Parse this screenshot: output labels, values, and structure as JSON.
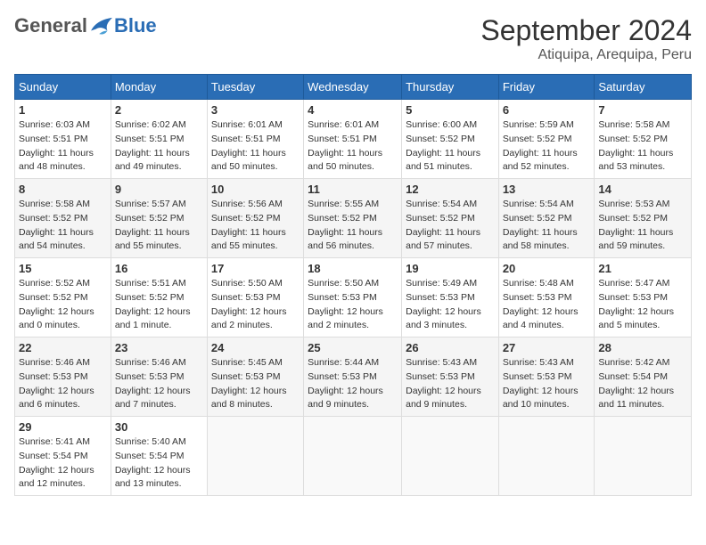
{
  "header": {
    "logo_general": "General",
    "logo_blue": "Blue",
    "title": "September 2024",
    "subtitle": "Atiquipa, Arequipa, Peru"
  },
  "weekdays": [
    "Sunday",
    "Monday",
    "Tuesday",
    "Wednesday",
    "Thursday",
    "Friday",
    "Saturday"
  ],
  "weeks": [
    [
      {
        "day": 1,
        "sunrise": "6:03 AM",
        "sunset": "5:51 PM",
        "daylight": "11 hours and 48 minutes."
      },
      {
        "day": 2,
        "sunrise": "6:02 AM",
        "sunset": "5:51 PM",
        "daylight": "11 hours and 49 minutes."
      },
      {
        "day": 3,
        "sunrise": "6:01 AM",
        "sunset": "5:51 PM",
        "daylight": "11 hours and 50 minutes."
      },
      {
        "day": 4,
        "sunrise": "6:01 AM",
        "sunset": "5:51 PM",
        "daylight": "11 hours and 50 minutes."
      },
      {
        "day": 5,
        "sunrise": "6:00 AM",
        "sunset": "5:52 PM",
        "daylight": "11 hours and 51 minutes."
      },
      {
        "day": 6,
        "sunrise": "5:59 AM",
        "sunset": "5:52 PM",
        "daylight": "11 hours and 52 minutes."
      },
      {
        "day": 7,
        "sunrise": "5:58 AM",
        "sunset": "5:52 PM",
        "daylight": "11 hours and 53 minutes."
      }
    ],
    [
      {
        "day": 8,
        "sunrise": "5:58 AM",
        "sunset": "5:52 PM",
        "daylight": "11 hours and 54 minutes."
      },
      {
        "day": 9,
        "sunrise": "5:57 AM",
        "sunset": "5:52 PM",
        "daylight": "11 hours and 55 minutes."
      },
      {
        "day": 10,
        "sunrise": "5:56 AM",
        "sunset": "5:52 PM",
        "daylight": "11 hours and 55 minutes."
      },
      {
        "day": 11,
        "sunrise": "5:55 AM",
        "sunset": "5:52 PM",
        "daylight": "11 hours and 56 minutes."
      },
      {
        "day": 12,
        "sunrise": "5:54 AM",
        "sunset": "5:52 PM",
        "daylight": "11 hours and 57 minutes."
      },
      {
        "day": 13,
        "sunrise": "5:54 AM",
        "sunset": "5:52 PM",
        "daylight": "11 hours and 58 minutes."
      },
      {
        "day": 14,
        "sunrise": "5:53 AM",
        "sunset": "5:52 PM",
        "daylight": "11 hours and 59 minutes."
      }
    ],
    [
      {
        "day": 15,
        "sunrise": "5:52 AM",
        "sunset": "5:52 PM",
        "daylight": "12 hours and 0 minutes."
      },
      {
        "day": 16,
        "sunrise": "5:51 AM",
        "sunset": "5:52 PM",
        "daylight": "12 hours and 1 minute."
      },
      {
        "day": 17,
        "sunrise": "5:50 AM",
        "sunset": "5:53 PM",
        "daylight": "12 hours and 2 minutes."
      },
      {
        "day": 18,
        "sunrise": "5:50 AM",
        "sunset": "5:53 PM",
        "daylight": "12 hours and 2 minutes."
      },
      {
        "day": 19,
        "sunrise": "5:49 AM",
        "sunset": "5:53 PM",
        "daylight": "12 hours and 3 minutes."
      },
      {
        "day": 20,
        "sunrise": "5:48 AM",
        "sunset": "5:53 PM",
        "daylight": "12 hours and 4 minutes."
      },
      {
        "day": 21,
        "sunrise": "5:47 AM",
        "sunset": "5:53 PM",
        "daylight": "12 hours and 5 minutes."
      }
    ],
    [
      {
        "day": 22,
        "sunrise": "5:46 AM",
        "sunset": "5:53 PM",
        "daylight": "12 hours and 6 minutes."
      },
      {
        "day": 23,
        "sunrise": "5:46 AM",
        "sunset": "5:53 PM",
        "daylight": "12 hours and 7 minutes."
      },
      {
        "day": 24,
        "sunrise": "5:45 AM",
        "sunset": "5:53 PM",
        "daylight": "12 hours and 8 minutes."
      },
      {
        "day": 25,
        "sunrise": "5:44 AM",
        "sunset": "5:53 PM",
        "daylight": "12 hours and 9 minutes."
      },
      {
        "day": 26,
        "sunrise": "5:43 AM",
        "sunset": "5:53 PM",
        "daylight": "12 hours and 9 minutes."
      },
      {
        "day": 27,
        "sunrise": "5:43 AM",
        "sunset": "5:53 PM",
        "daylight": "12 hours and 10 minutes."
      },
      {
        "day": 28,
        "sunrise": "5:42 AM",
        "sunset": "5:54 PM",
        "daylight": "12 hours and 11 minutes."
      }
    ],
    [
      {
        "day": 29,
        "sunrise": "5:41 AM",
        "sunset": "5:54 PM",
        "daylight": "12 hours and 12 minutes."
      },
      {
        "day": 30,
        "sunrise": "5:40 AM",
        "sunset": "5:54 PM",
        "daylight": "12 hours and 13 minutes."
      },
      null,
      null,
      null,
      null,
      null
    ]
  ]
}
